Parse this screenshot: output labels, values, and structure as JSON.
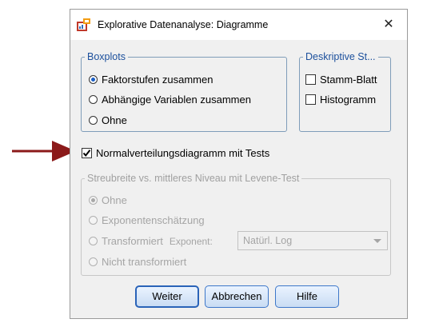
{
  "dialog": {
    "title": "Explorative Datenanalyse: Diagramme",
    "close_glyph": "✕"
  },
  "boxplots": {
    "legend": "Boxplots",
    "options": [
      {
        "label": "Faktorstufen zusammen",
        "selected": true
      },
      {
        "label": "Abhängige Variablen zusammen",
        "selected": false
      },
      {
        "label": "Ohne",
        "selected": false
      }
    ]
  },
  "descriptive": {
    "legend": "Deskriptive St...",
    "options": [
      {
        "label": "Stamm-Blatt",
        "checked": false
      },
      {
        "label": "Histogramm",
        "checked": false
      }
    ]
  },
  "normal_plot": {
    "label": "Normalverteilungsdiagramm mit Tests",
    "checked": true
  },
  "spread": {
    "legend": "Streubreite vs. mittleres Niveau mit Levene-Test",
    "enabled": false,
    "options": [
      {
        "label": "Ohne",
        "selected": true
      },
      {
        "label": "Exponentenschätzung",
        "selected": false
      },
      {
        "label": "Transformiert",
        "selected": false
      },
      {
        "label": "Nicht transformiert",
        "selected": false
      }
    ],
    "exponent_label": "Exponent:",
    "exponent_value": "Natürl. Log"
  },
  "buttons": {
    "continue": "Weiter",
    "cancel": "Abbrechen",
    "help": "Hilfe"
  },
  "colors": {
    "arrow": "#8b1a1a",
    "legend": "#1b4f9c",
    "button_border": "#3d77c9"
  }
}
